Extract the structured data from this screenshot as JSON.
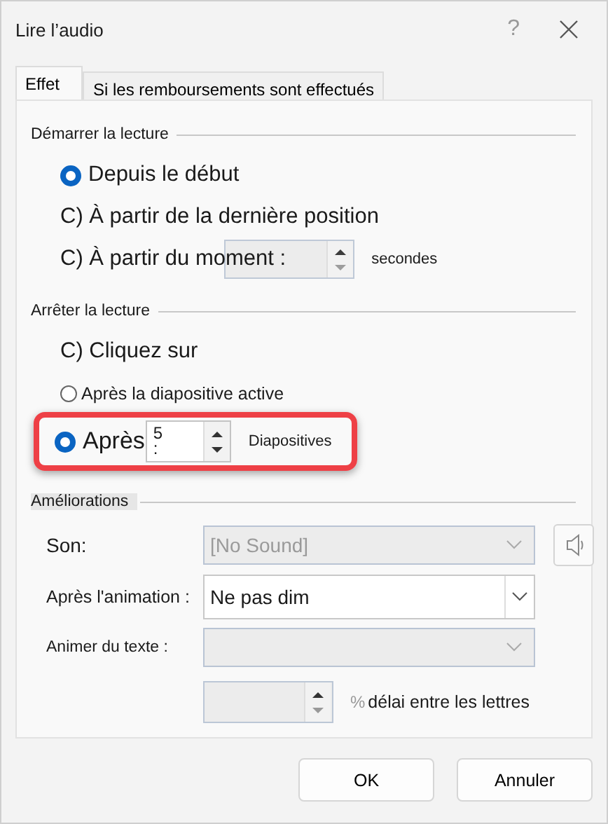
{
  "window": {
    "title": "Lire l’audio",
    "help": "?"
  },
  "tabs": [
    {
      "label": "Effet",
      "selected": true
    },
    {
      "label": "Si les remboursements sont effectués",
      "selected": false
    }
  ],
  "start": {
    "heading": "Démarrer la lecture",
    "options": [
      {
        "kind": "radio",
        "label": "Depuis le début",
        "selected": true
      },
      {
        "kind": "plain",
        "label": "C) À partir de la dernière position"
      },
      {
        "kind": "time",
        "label": "C) À partir du moment :",
        "unit": "secondes"
      }
    ]
  },
  "stop": {
    "heading": "Arrêter la lecture",
    "options": [
      {
        "kind": "plain",
        "label": "C) Cliquez sur"
      },
      {
        "kind": "radio",
        "label": "Après la diapositive active",
        "selected": false
      },
      {
        "kind": "count",
        "label": "Après",
        "selected": true,
        "value": "5",
        "suffix": ":",
        "unit": "Diapositives",
        "highlighted": true
      }
    ]
  },
  "enhancements": {
    "heading": "Améliorations",
    "sound": {
      "label": "Son:",
      "value": "[No Sound]",
      "disabled": true
    },
    "after_animation": {
      "label": "Après l'animation :",
      "value": "Ne pas dim",
      "disabled": false
    },
    "animate_text": {
      "label": "Animer du texte :",
      "disabled": true
    },
    "delay": {
      "percent": "%",
      "label": "délai entre les lettres"
    }
  },
  "buttons": [
    "OK",
    "Annuler"
  ]
}
